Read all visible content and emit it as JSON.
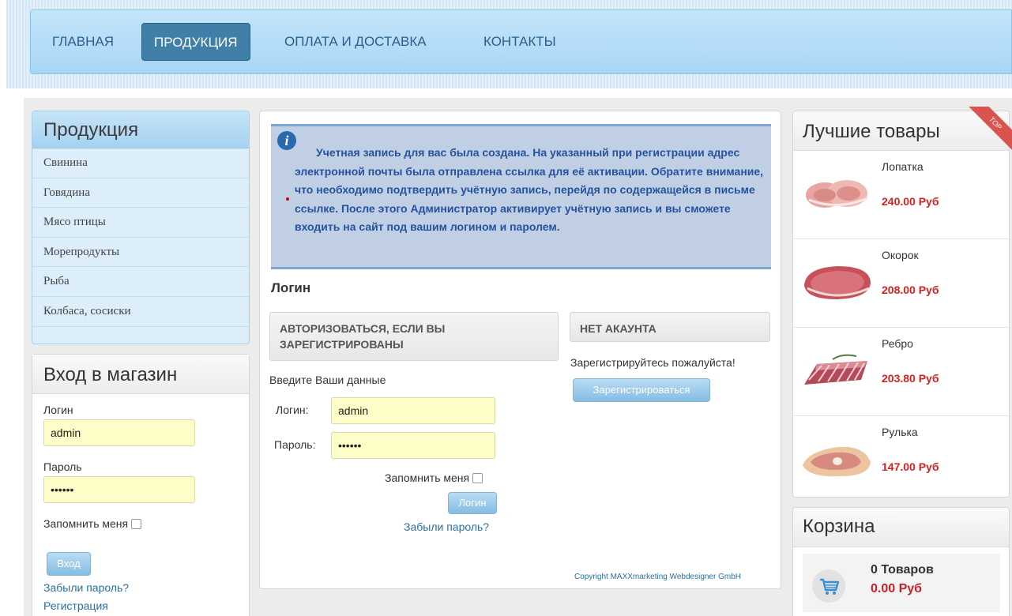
{
  "nav": {
    "items": [
      {
        "label": "ГЛАВНАЯ",
        "active": false
      },
      {
        "label": "ПРОДУКЦИЯ",
        "active": true
      },
      {
        "label": "ОПЛАТА И ДОСТАВКА",
        "active": false
      },
      {
        "label": "КОНТАКТЫ",
        "active": false
      }
    ]
  },
  "sidebar": {
    "categories_title": "Продукция",
    "categories": [
      "Свинина",
      "Говядина",
      "Мясо птицы",
      "Морепродукты",
      "Рыба",
      "Колбаса, сосиски"
    ],
    "login": {
      "title": "Вход в магазин",
      "login_label": "Логин",
      "login_value": "admin",
      "password_label": "Пароль",
      "password_value": "••••••",
      "remember_label": "Запомнить меня",
      "submit_label": "Вход",
      "forgot_link": "Забыли пароль?",
      "register_link": "Регистрация"
    }
  },
  "main": {
    "info_message": "Учетная запись для вас была создана. На указанный при регистрации адрес электронной почты была отправлена ссылка для её активации. Обратите внимание, что необходимо подтвердить учётную запись, перейдя по содержащейся в письме ссылке. После этого Администратор активирует учётную запись и вы сможете входить на сайт под вашим логином и паролем.",
    "section_title": "Логин",
    "auth_box_title": "АВТОРИЗОВАТЬСЯ, ЕСЛИ ВЫ ЗАРЕГИСТРИРОВАНЫ",
    "enter_data_text": "Введите Ваши данные",
    "login_label": "Логин:",
    "login_value": "admin",
    "password_label": "Пароль:",
    "password_value": "••••••",
    "remember_label": "Запомнить меня",
    "submit_label": "Логин",
    "forgot_link": "Забыли пароль?",
    "no_account_title": "НЕТ АКАУНТА",
    "register_prompt": "Зарегистрируйтесь пожалуйста!",
    "register_button": "Зарегистрироваться",
    "copyright": "Copyright MAXXmarketing Webdesigner GmbH"
  },
  "best": {
    "title": "Лучшие товары",
    "ribbon": "TOP",
    "products": [
      {
        "name": "Лопатка",
        "price": "240.00 Руб"
      },
      {
        "name": "Окорок",
        "price": "208.00 Руб"
      },
      {
        "name": "Ребро",
        "price": "203.80 Руб"
      },
      {
        "name": "Рулька",
        "price": "147.00 Руб"
      }
    ]
  },
  "cart": {
    "title": "Корзина",
    "count": "0 Товаров",
    "sum": "0.00 Руб"
  }
}
